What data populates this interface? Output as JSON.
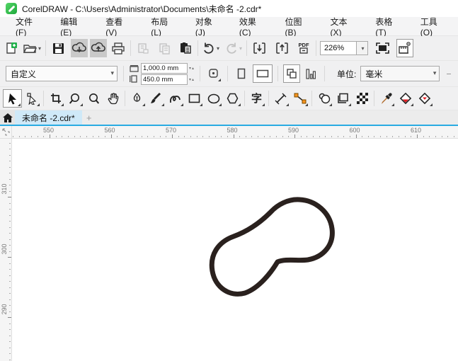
{
  "window": {
    "title": "CorelDRAW - C:\\Users\\Administrator\\Documents\\未命名 -2.cdr*"
  },
  "menus": [
    {
      "label": "文件(F)"
    },
    {
      "label": "编辑(E)"
    },
    {
      "label": "查看(V)"
    },
    {
      "label": "布局(L)"
    },
    {
      "label": "对象(J)"
    },
    {
      "label": "效果(C)"
    },
    {
      "label": "位图(B)"
    },
    {
      "label": "文本(X)"
    },
    {
      "label": "表格(T)"
    },
    {
      "label": "工具(O)"
    }
  ],
  "toolbar": {
    "zoom_level": "226%",
    "pdf_label": "PDF"
  },
  "propbar": {
    "page_preset": "自定义",
    "page_width": "1,000.0 mm",
    "page_height": "450.0 mm",
    "units_label": "单位:",
    "units_value": "毫米"
  },
  "toolbox": {
    "text_glyph": "字"
  },
  "tabs": {
    "active": "未命名 -2.cdr*",
    "new_tab": "+"
  },
  "rulers": {
    "horizontal": {
      "labels": [
        "550",
        "560",
        "570",
        "580",
        "590",
        "600",
        "610"
      ],
      "start": 53,
      "spacing": 86.5,
      "minor_step": 8.65
    },
    "vertical": {
      "labels": [
        "310",
        "300",
        "290"
      ],
      "start": 82,
      "spacing": 85,
      "minor_step": 8.5
    }
  },
  "colors": {
    "accent": "#29abe2",
    "tab_bg": "#cfe9f8",
    "icon_green": "#22b14c",
    "stroke": "#2a211e"
  }
}
